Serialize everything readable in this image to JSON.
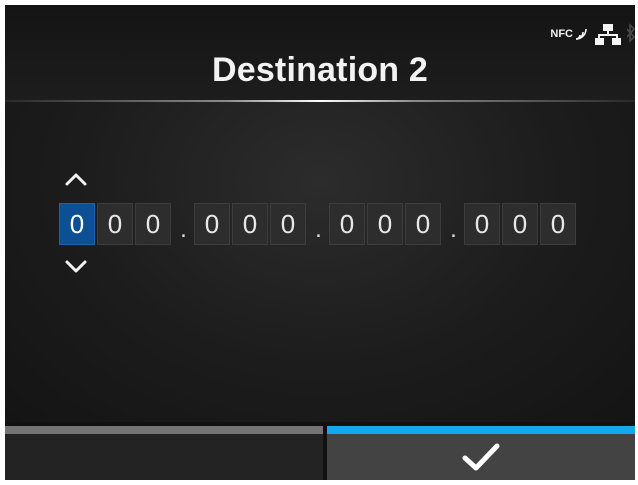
{
  "header": {
    "title": "Destination 2",
    "status_icons": {
      "nfc_label": "NFC",
      "icons": [
        "nfc-icon",
        "network-icon",
        "bluetooth-icon"
      ]
    }
  },
  "ip_editor": {
    "octets": [
      [
        "0",
        "0",
        "0"
      ],
      [
        "0",
        "0",
        "0"
      ],
      [
        "0",
        "0",
        "0"
      ],
      [
        "0",
        "0",
        "0"
      ]
    ],
    "separator": ".",
    "selected_digit": "octet 1, digit 1",
    "up_icon": "chevron-up-icon",
    "down_icon": "chevron-down-icon"
  },
  "footer": {
    "left_button": {
      "label": "",
      "active": false,
      "bar_color": "#747474"
    },
    "right_button": {
      "icon": "checkmark-icon",
      "active": true,
      "bar_color": "#12a9ea"
    }
  },
  "colors": {
    "selection": "#0c4f92",
    "accent": "#12a9ea",
    "background": "#111111"
  }
}
